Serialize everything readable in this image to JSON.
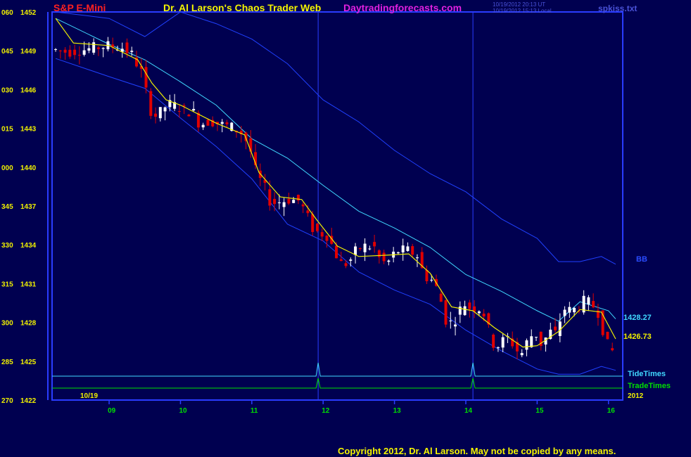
{
  "header": {
    "symbol": "S&P E-Mini",
    "site_title": "Dr. Al Larson's Chaos Trader Web",
    "website": "Daytradingforecasts.com",
    "timestamp_ut": "10/19/2012 20:13 UT",
    "timestamp_local": "10/19/2012 15:13 Local",
    "file": "spkiss.txt"
  },
  "copyright": "Copyright 2012, Dr. Al Larson. May not be copied by any means.",
  "colors": {
    "background": "#000050",
    "frame": "#2a3cff",
    "up_candle": "#ffffff",
    "down_candle": "#e00000",
    "moving_average": "#f0f000",
    "middle_band": "#40d8ff",
    "outer_bands": "#2040ff",
    "tide_times": "#40d8ff",
    "trade_times": "#00e000",
    "x_tick_labels": "#00e000",
    "y_tick_labels": "#f0f000"
  },
  "chart_data": {
    "type": "candlestick",
    "date_label": "10/19",
    "year_label": "2012",
    "band_label": "BB",
    "band_values": [
      "1428.27",
      "1426.73"
    ],
    "indicator_labels": [
      "TideTimes",
      "TradeTimes"
    ],
    "y_ticks": [
      {
        "code": "060",
        "price": "1452"
      },
      {
        "code": "045",
        "price": "1449"
      },
      {
        "code": "030",
        "price": "1446"
      },
      {
        "code": "015",
        "price": "1443"
      },
      {
        "code": "000",
        "price": "1440"
      },
      {
        "code": "345",
        "price": "1437"
      },
      {
        "code": "330",
        "price": "1434"
      },
      {
        "code": "315",
        "price": "1431"
      },
      {
        "code": "300",
        "price": "1428"
      },
      {
        "code": "285",
        "price": "1425"
      },
      {
        "code": "270",
        "price": "1422"
      }
    ],
    "ylim": [
      1422,
      1452
    ],
    "x_ticks": [
      "09",
      "10",
      "11",
      "12",
      "13",
      "14",
      "15",
      "16"
    ],
    "xlim_hours": [
      8.2,
      16.2
    ],
    "vertical_markers_hours": [
      11.93,
      14.1
    ],
    "tide_spikes_hours": [
      11.93,
      14.1
    ],
    "trade_spikes_hours": [
      11.93,
      14.1
    ],
    "price_path": [
      [
        8.25,
        1449.1
      ],
      [
        8.45,
        1448.9
      ],
      [
        8.7,
        1449.1
      ],
      [
        9.0,
        1449.4
      ],
      [
        9.2,
        1449.3
      ],
      [
        9.35,
        1448.7
      ],
      [
        9.5,
        1447.2
      ],
      [
        9.6,
        1444.5
      ],
      [
        9.7,
        1443.9
      ],
      [
        9.85,
        1444.9
      ],
      [
        10.0,
        1444.7
      ],
      [
        10.1,
        1444.3
      ],
      [
        10.2,
        1444.4
      ],
      [
        10.3,
        1443.3
      ],
      [
        10.45,
        1443.6
      ],
      [
        10.6,
        1443.3
      ],
      [
        10.75,
        1443.1
      ],
      [
        10.9,
        1442.6
      ],
      [
        11.0,
        1441.6
      ],
      [
        11.1,
        1439.4
      ],
      [
        11.2,
        1438.6
      ],
      [
        11.3,
        1437.2
      ],
      [
        11.4,
        1437.3
      ],
      [
        11.55,
        1437.5
      ],
      [
        11.7,
        1437.4
      ],
      [
        11.8,
        1436.3
      ],
      [
        11.9,
        1435.1
      ],
      [
        12.0,
        1434.9
      ],
      [
        12.1,
        1434.7
      ],
      [
        12.2,
        1433.4
      ],
      [
        12.3,
        1432.4
      ],
      [
        12.4,
        1432.7
      ],
      [
        12.5,
        1433.6
      ],
      [
        12.6,
        1433.9
      ],
      [
        12.75,
        1433.8
      ],
      [
        12.85,
        1432.6
      ],
      [
        12.95,
        1432.7
      ],
      [
        13.05,
        1433.5
      ],
      [
        13.2,
        1433.6
      ],
      [
        13.35,
        1433.2
      ],
      [
        13.45,
        1431.6
      ],
      [
        13.55,
        1431.3
      ],
      [
        13.65,
        1430.4
      ],
      [
        13.75,
        1428.2
      ],
      [
        13.85,
        1427.9
      ],
      [
        14.0,
        1429.5
      ],
      [
        14.1,
        1429.1
      ],
      [
        14.2,
        1429.2
      ],
      [
        14.3,
        1428.6
      ],
      [
        14.4,
        1426.4
      ],
      [
        14.5,
        1426.2
      ],
      [
        14.6,
        1426.9
      ],
      [
        14.7,
        1426.3
      ],
      [
        14.8,
        1425.4
      ],
      [
        14.9,
        1426.6
      ],
      [
        15.0,
        1427.3
      ],
      [
        15.1,
        1426.2
      ],
      [
        15.2,
        1427.3
      ],
      [
        15.3,
        1427.1
      ],
      [
        15.4,
        1429.1
      ],
      [
        15.5,
        1428.9
      ],
      [
        15.6,
        1429.1
      ],
      [
        15.7,
        1429.7
      ],
      [
        15.8,
        1429.4
      ],
      [
        15.9,
        1428.7
      ],
      [
        16.0,
        1426.4
      ],
      [
        16.1,
        1425.7
      ]
    ],
    "bands": {
      "middle": [
        [
          8.25,
          1451.5
        ],
        [
          9.0,
          1449.5
        ],
        [
          9.5,
          1448.3
        ],
        [
          10.0,
          1446.6
        ],
        [
          10.5,
          1444.8
        ],
        [
          11.0,
          1442.2
        ],
        [
          11.5,
          1440.7
        ],
        [
          12.0,
          1438.6
        ],
        [
          12.5,
          1436.6
        ],
        [
          13.0,
          1435.3
        ],
        [
          13.5,
          1433.8
        ],
        [
          14.0,
          1431.7
        ],
        [
          14.5,
          1430.4
        ],
        [
          15.0,
          1428.9
        ],
        [
          15.3,
          1428.1
        ],
        [
          15.6,
          1429.6
        ],
        [
          16.0,
          1428.9
        ],
        [
          16.1,
          1428.27
        ]
      ],
      "upper": [
        [
          8.25,
          1452.0
        ],
        [
          9.0,
          1451.5
        ],
        [
          9.5,
          1450.1
        ],
        [
          10.0,
          1452.0
        ],
        [
          10.5,
          1451.1
        ],
        [
          11.0,
          1449.9
        ],
        [
          11.5,
          1448.0
        ],
        [
          12.0,
          1445.2
        ],
        [
          12.5,
          1443.5
        ],
        [
          13.0,
          1441.3
        ],
        [
          13.5,
          1439.5
        ],
        [
          14.0,
          1438.1
        ],
        [
          14.5,
          1436.0
        ],
        [
          15.0,
          1434.5
        ],
        [
          15.3,
          1432.7
        ],
        [
          15.6,
          1432.7
        ],
        [
          15.9,
          1433.1
        ],
        [
          16.1,
          1432.5
        ]
      ],
      "lower": [
        [
          8.25,
          1448.4
        ],
        [
          9.0,
          1447.0
        ],
        [
          9.5,
          1446.1
        ],
        [
          10.0,
          1443.8
        ],
        [
          10.5,
          1441.6
        ],
        [
          11.0,
          1439.1
        ],
        [
          11.5,
          1435.6
        ],
        [
          12.0,
          1434.3
        ],
        [
          12.5,
          1431.9
        ],
        [
          13.0,
          1430.5
        ],
        [
          13.5,
          1429.4
        ],
        [
          14.0,
          1427.4
        ],
        [
          14.5,
          1425.8
        ],
        [
          15.0,
          1424.4
        ],
        [
          15.3,
          1424.0
        ],
        [
          15.6,
          1424.0
        ],
        [
          15.9,
          1424.6
        ],
        [
          16.1,
          1424.3
        ]
      ]
    },
    "moving_average": [
      [
        8.25,
        1451.5
      ],
      [
        8.5,
        1449.6
      ],
      [
        9.0,
        1449.4
      ],
      [
        9.4,
        1448.3
      ],
      [
        9.6,
        1446.5
      ],
      [
        9.8,
        1445.2
      ],
      [
        10.0,
        1444.8
      ],
      [
        10.5,
        1443.4
      ],
      [
        10.9,
        1442.5
      ],
      [
        11.1,
        1439.6
      ],
      [
        11.4,
        1437.7
      ],
      [
        11.7,
        1437.5
      ],
      [
        11.9,
        1436.0
      ],
      [
        12.2,
        1433.9
      ],
      [
        12.5,
        1433.1
      ],
      [
        12.9,
        1433.2
      ],
      [
        13.2,
        1433.3
      ],
      [
        13.5,
        1431.8
      ],
      [
        13.8,
        1429.2
      ],
      [
        14.1,
        1428.9
      ],
      [
        14.4,
        1427.6
      ],
      [
        14.8,
        1426.1
      ],
      [
        15.0,
        1426.2
      ],
      [
        15.3,
        1427.3
      ],
      [
        15.6,
        1429.0
      ],
      [
        15.9,
        1428.8
      ],
      [
        16.1,
        1426.73
      ]
    ]
  }
}
